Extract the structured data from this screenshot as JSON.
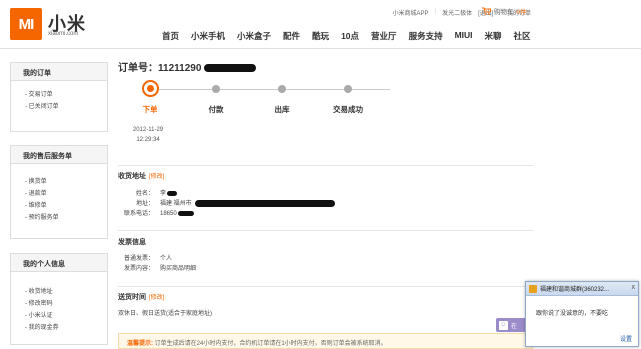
{
  "header": {
    "logo_text": "MI",
    "brand": "小米",
    "brand_sub": "xiaomi.com",
    "top_links": [
      "小米商城APP",
      "发光二极体",
      "[退出]",
      "我的订单"
    ],
    "cart_label": "购物车",
    "cart_count": "0件",
    "nav": [
      "首页",
      "小米手机",
      "小米盒子",
      "配件",
      "酷玩",
      "10点",
      "营业厅",
      "服务支持",
      "MIUI",
      "米聊",
      "社区"
    ]
  },
  "sidebar": {
    "orders": {
      "title": "我的订单",
      "items": [
        "交易订单",
        "已关闭订单"
      ]
    },
    "after_sales": {
      "title": "我的售后服务单",
      "items": [
        "换货单",
        "退款单",
        "维修单",
        "预约服务单"
      ]
    },
    "personal": {
      "title": "我的个人信息",
      "items": [
        "收货地址",
        "修改密码",
        "小米认证",
        "我的现金券"
      ]
    }
  },
  "order": {
    "number_label": "订单号：",
    "number_visible": "11211290",
    "steps": [
      {
        "label": "下单",
        "time_date": "2012-11-29",
        "time_clock": "12:29:34"
      },
      {
        "label": "付款"
      },
      {
        "label": "出库"
      },
      {
        "label": "交易成功"
      }
    ]
  },
  "shipping": {
    "title": "收货地址",
    "edit": "[修改]",
    "name_key": "姓名：",
    "name_val": "李",
    "addr_key": "地址：",
    "addr_val": "福建 福州市",
    "phone_key": "联系电话：",
    "phone_val": "18650"
  },
  "invoice": {
    "title": "发票信息",
    "type_key": "普通发票：",
    "type_val": "个人",
    "content_key": "发票内容：",
    "content_val": "购买商品明细"
  },
  "delivery": {
    "title": "送货时间",
    "edit": "[修改]",
    "value": "双休日、假日送货(适合于家庭地址)"
  },
  "notice": {
    "tag": "温馨提示:",
    "text": "订单生成后请在24小时内支付，合约机订单请在1小时内支付，否则订单会被系统取消。"
  },
  "float_button": {
    "label": "在"
  },
  "popup": {
    "title": "福建和谐商城群(360232...",
    "close": "x",
    "message": "跟你说了没诚意的，不要吃",
    "settings": "设置"
  }
}
